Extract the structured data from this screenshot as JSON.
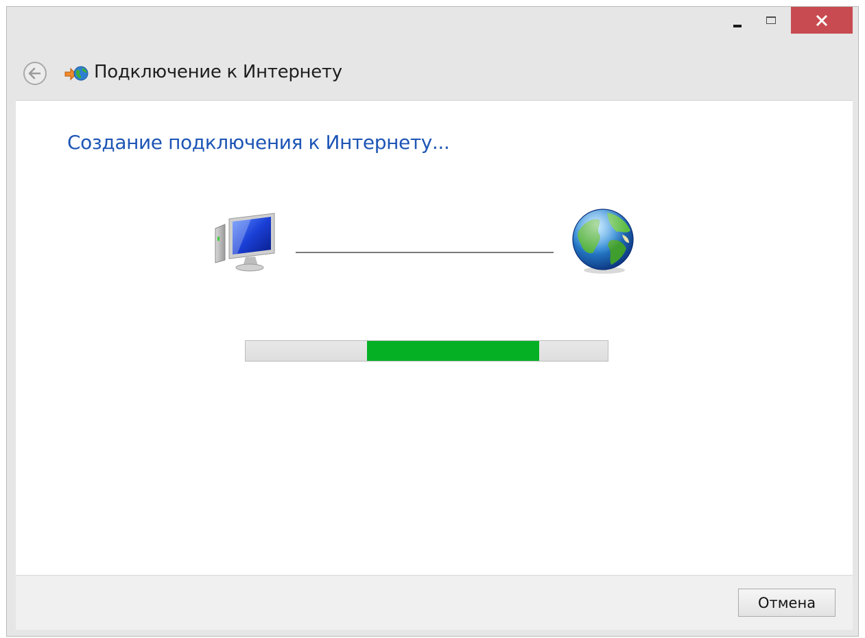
{
  "window": {
    "controls": {
      "minimize": "minimize-icon",
      "maximize": "maximize-icon",
      "close": "close-icon"
    },
    "close_color": "#c74b50"
  },
  "header": {
    "back_icon": "back-arrow-icon",
    "app_icon": "network-globe-icon",
    "title": "Подключение к Интернету"
  },
  "main": {
    "heading": "Создание подключения к Интернету...",
    "heading_color": "#1d55b5",
    "computer_icon": "computer-icon",
    "globe_icon": "globe-icon",
    "progress": {
      "style": "marquee",
      "chunk_start": 0.335,
      "chunk_end": 0.81,
      "color": "#06b025"
    }
  },
  "footer": {
    "cancel_label": "Отмена"
  }
}
